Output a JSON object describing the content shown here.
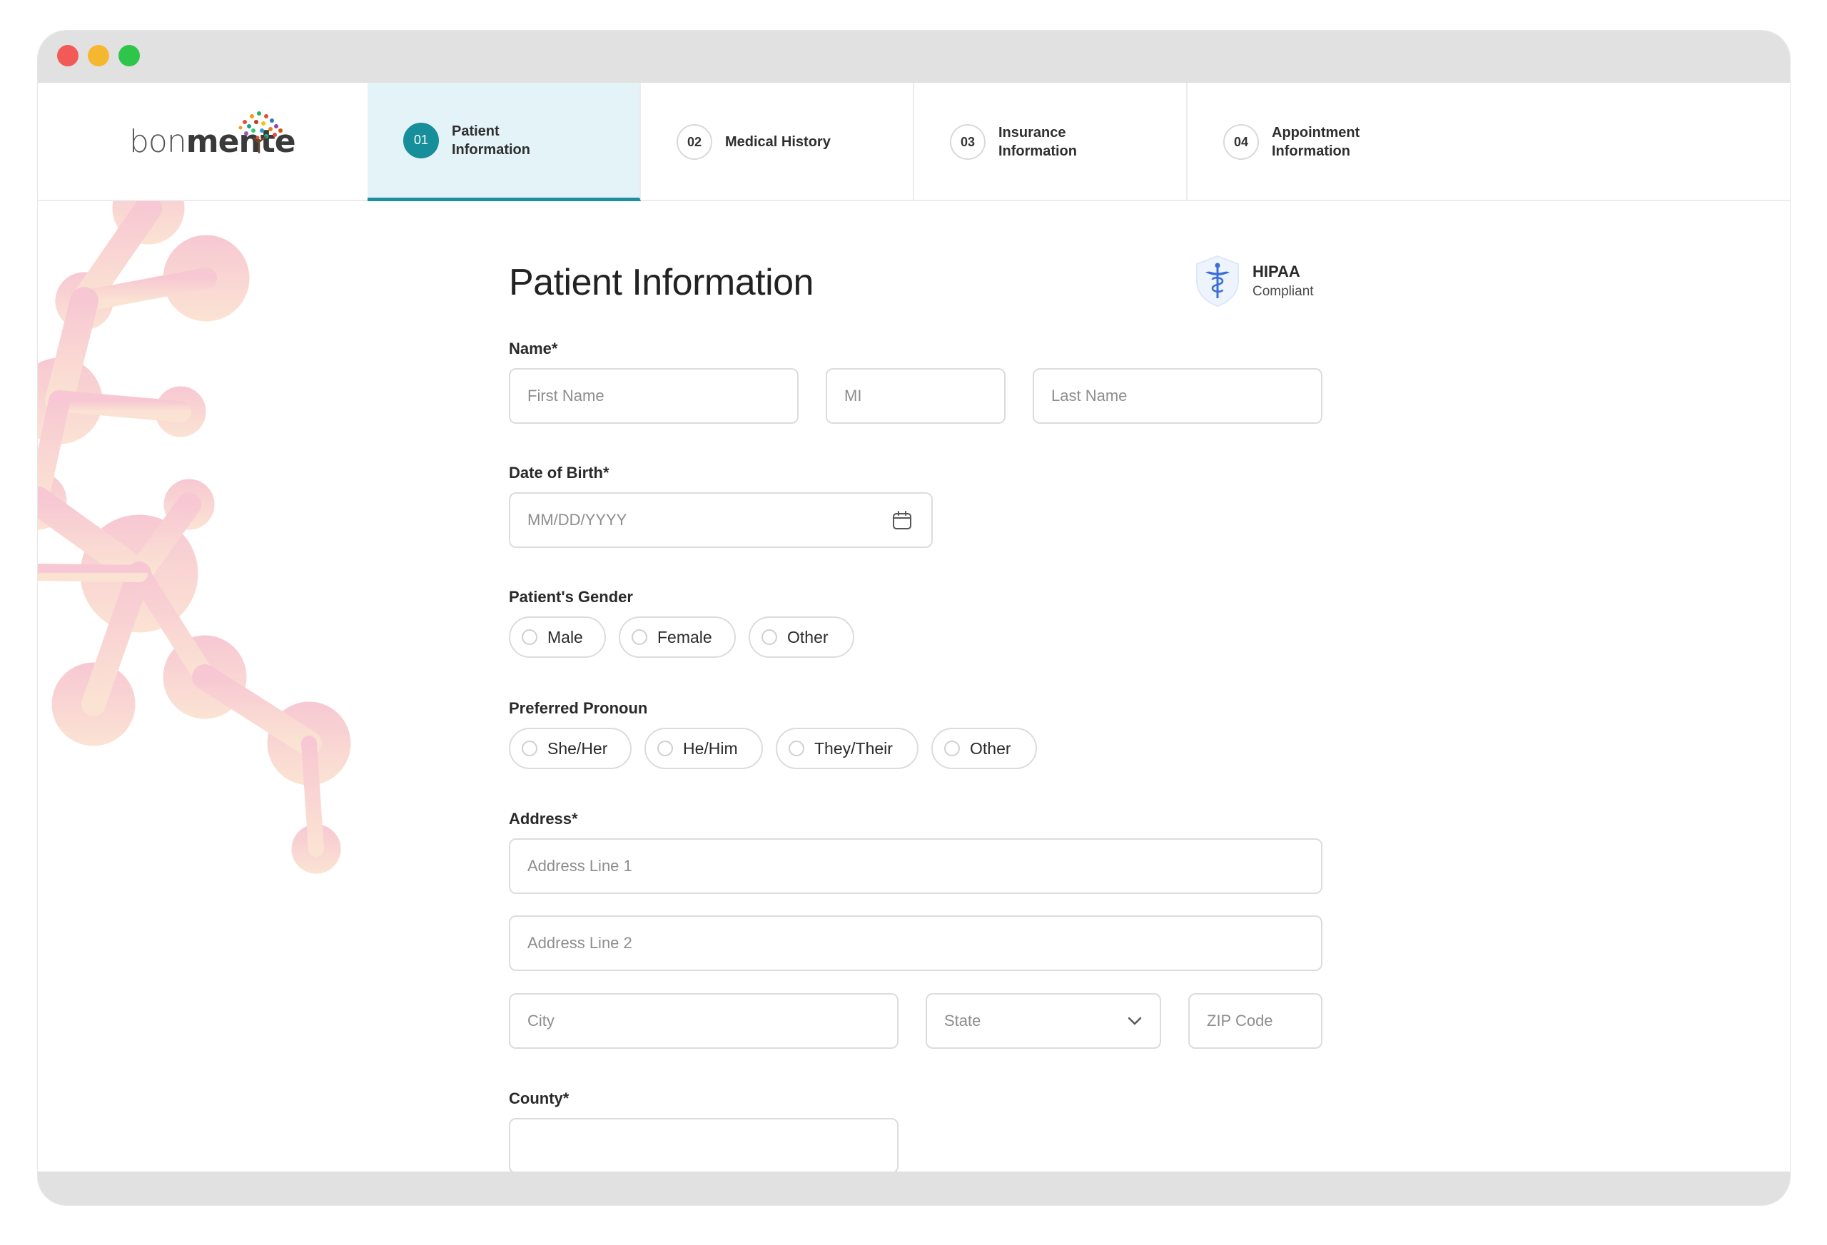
{
  "brand": {
    "name_light": "bon",
    "name_bold": "mente"
  },
  "steps": [
    {
      "num": "01",
      "label": "Patient\nInformation",
      "active": true
    },
    {
      "num": "02",
      "label": "Medical History",
      "active": false
    },
    {
      "num": "03",
      "label": "Insurance\nInformation",
      "active": false
    },
    {
      "num": "04",
      "label": "Appointment\nInformation",
      "active": false
    }
  ],
  "page": {
    "title": "Patient Information",
    "hipaa_title": "HIPAA",
    "hipaa_sub": "Compliant"
  },
  "name": {
    "label": "Name*",
    "first_placeholder": "First Name",
    "mi_placeholder": "MI",
    "last_placeholder": "Last Name"
  },
  "dob": {
    "label": "Date of Birth*",
    "placeholder": "MM/DD/YYYY"
  },
  "gender": {
    "label": "Patient's Gender",
    "options": [
      "Male",
      "Female",
      "Other"
    ]
  },
  "pronoun": {
    "label": "Preferred Pronoun",
    "options": [
      "She/Her",
      "He/Him",
      "They/Their",
      "Other"
    ]
  },
  "address": {
    "label": "Address*",
    "line1_placeholder": "Address Line 1",
    "line2_placeholder": "Address Line 2",
    "city_placeholder": "City",
    "state_placeholder": "State",
    "zip_placeholder": "ZIP Code"
  },
  "county": {
    "label": "County*",
    "value": ""
  },
  "colors": {
    "accent": "#168f9b",
    "active_step_bg": "#e4f3f7",
    "hipaa_blue": "#3b6fd8"
  }
}
